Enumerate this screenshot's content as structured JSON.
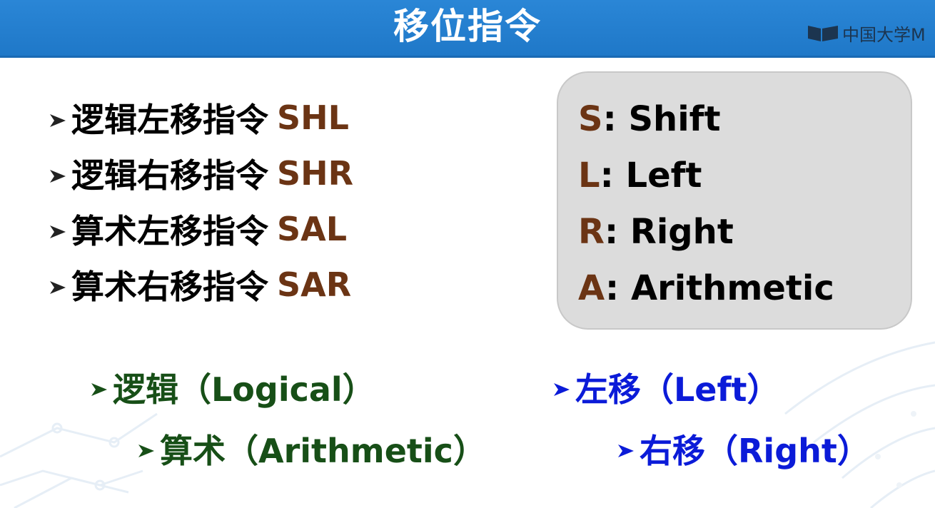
{
  "header": {
    "title": "移位指令",
    "brand": "中国大学M"
  },
  "instructions": [
    {
      "cn": "逻辑左移指令",
      "code": "SHL"
    },
    {
      "cn": "逻辑右移指令",
      "code": "SHR"
    },
    {
      "cn": "算术左移指令",
      "code": "SAL"
    },
    {
      "cn": "算术右移指令",
      "code": "SAR"
    }
  ],
  "legend": [
    {
      "letter": "S",
      "rest": ": Shift"
    },
    {
      "letter": "L",
      "rest": ": Left"
    },
    {
      "letter": "R",
      "rest": ": Right"
    },
    {
      "letter": "A",
      "rest": ": Arithmetic"
    }
  ],
  "definitions": {
    "logical": "逻辑（Logical）",
    "arithmetic": "算术（Arithmetic）",
    "left": "左移（Left）",
    "right": "右移（Right）"
  },
  "colors": {
    "header": "#1f78c8",
    "code": "#6b3414",
    "green": "#174f17",
    "blue": "#0b1bd8",
    "legend_bg": "#dcdcdc"
  },
  "icons": {
    "bullet": "arrow-bullet-icon",
    "brand": "book-logo-icon"
  }
}
